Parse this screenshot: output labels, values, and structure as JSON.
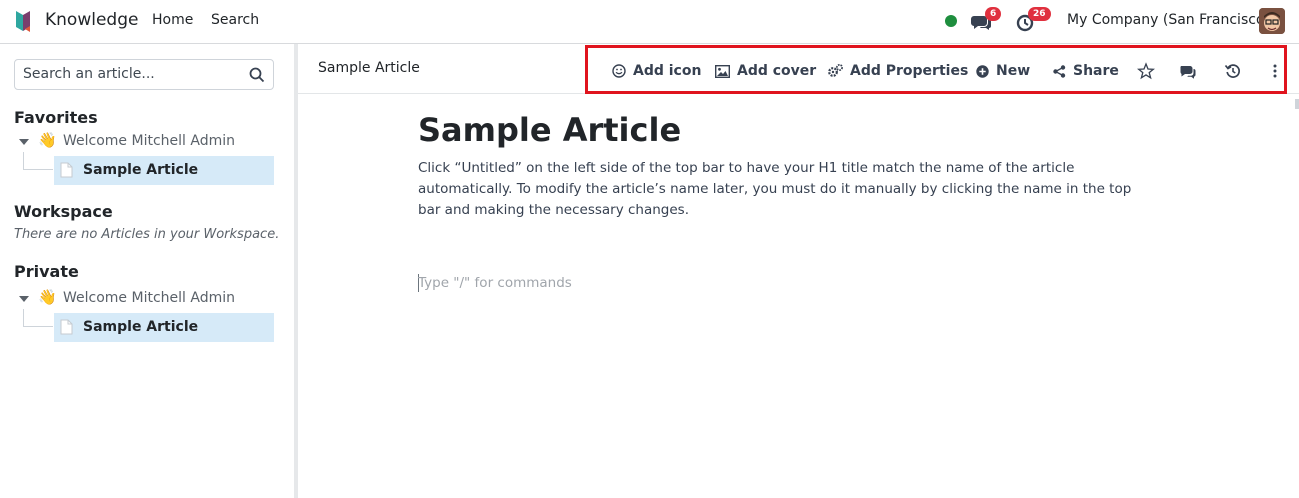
{
  "app": {
    "name": "Knowledge",
    "nav": [
      "Home",
      "Search"
    ],
    "company": "My Company (San Francisco)",
    "messages_badge": "6",
    "activities_badge": "26"
  },
  "sidebar": {
    "search_placeholder": "Search an article...",
    "favorites": {
      "title": "Favorites",
      "root": "Welcome Mitchell Admin",
      "child": "Sample Article"
    },
    "workspace": {
      "title": "Workspace",
      "empty": "There are no Articles in your Workspace."
    },
    "private": {
      "title": "Private",
      "root": "Welcome Mitchell Admin",
      "child": "Sample Article"
    }
  },
  "topbar": {
    "article_name": "Sample Article",
    "buttons": {
      "add_icon": "Add icon",
      "add_cover": "Add cover",
      "add_properties": "Add Properties",
      "new": "New",
      "share": "Share"
    }
  },
  "article": {
    "title": "Sample Article",
    "body": "Click “Untitled” on the left side of the top bar to have your H1 title match the name of the article automatically. To modify the article’s name later, you must do it manually by clicking the name in the top bar and making the necessary changes.",
    "command_hint": "Type \"/\" for commands"
  },
  "colors": {
    "highlight_border": "#e0141e",
    "selected_row": "#d6eaf8",
    "online": "#1e8e3e",
    "badge": "#e0303e"
  }
}
